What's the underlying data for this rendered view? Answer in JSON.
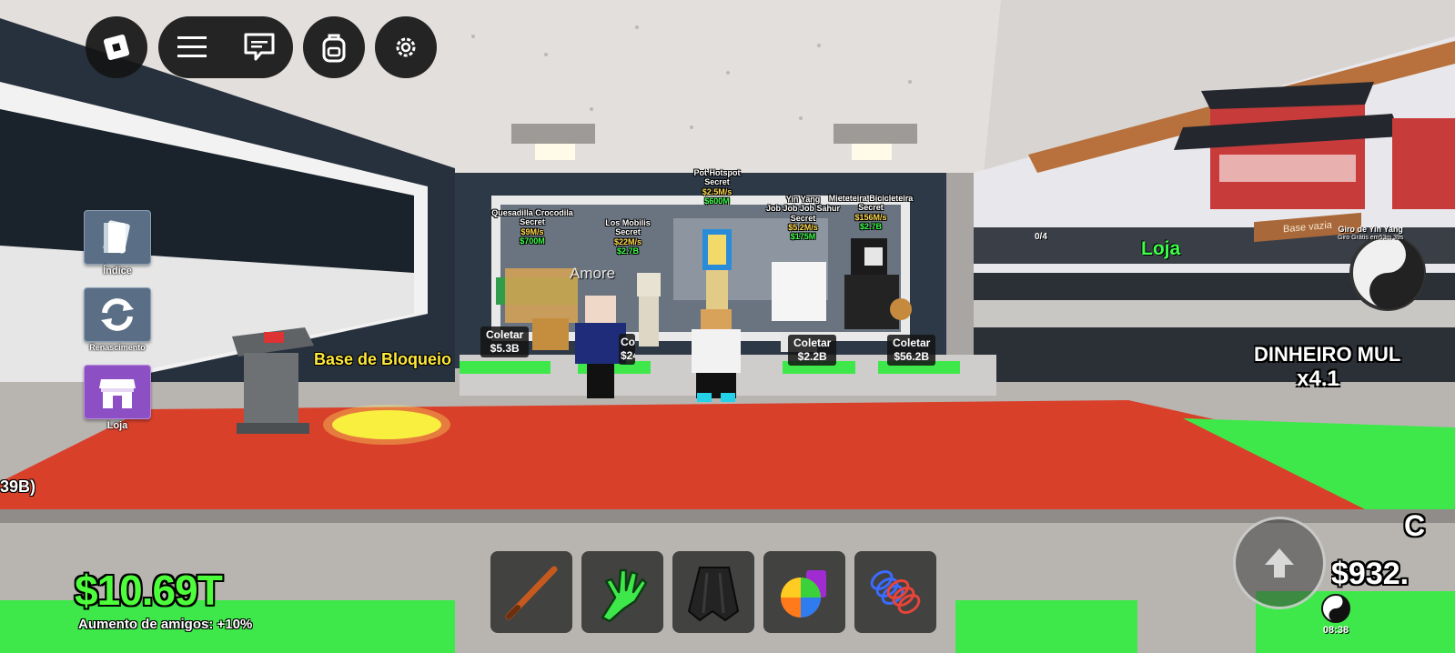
{
  "hud": {
    "icons": [
      "roblox-logo-icon",
      "menu-icon",
      "chat-icon",
      "backpack-icon",
      "settings-icon"
    ]
  },
  "side_menu": [
    {
      "label": "Índice",
      "icon": "book-icon",
      "color": "#5a6f86"
    },
    {
      "label": "Renascimento",
      "icon": "rebirth-icon",
      "color": "#5a6f86"
    },
    {
      "label": "Loja",
      "icon": "shop-icon",
      "color": "#8d4fc4"
    }
  ],
  "world": {
    "base_label": "Base de Bloqueio",
    "player_name": "Amore",
    "shop_sign": "Loja",
    "empty_base": "Base vazia",
    "counter": "0/4",
    "wheel_title": "Giro de Yin Yang",
    "wheel_sub": "Giro Grátis em53m 39s",
    "left_partial": "39B)"
  },
  "brainrots": [
    {
      "name": "Quesadilla Crocodila",
      "rarity": "Secret",
      "rate": "$9M/s",
      "price": "$700M",
      "collect": "Coletar",
      "amount": "$5.3B"
    },
    {
      "name": "Los Mobilis",
      "rarity": "Secret",
      "rate": "$22M/s",
      "price": "$2.7B",
      "collect": "Coletar",
      "amount": "$24B"
    },
    {
      "name": "Pot Hotspot",
      "rarity": "Secret",
      "rate": "$2.5M/s",
      "price": "$600M",
      "collect": "Coletar",
      "amount": ""
    },
    {
      "name": "Job Job Job Sahur",
      "rarity": "Secret",
      "rate": "$5.2M/s",
      "price": "$175M",
      "collect": "Coletar",
      "amount": "$2.2B"
    },
    {
      "name": "Mieteteira Bicicleteira",
      "rarity": "Secret",
      "rate": "$156M/s",
      "price": "$2.7B",
      "collect": "Coletar",
      "amount": "$56.2B"
    }
  ],
  "yin_yang_label": "Yin Yang",
  "money_multiplier": {
    "title": "DINHEIRO MUL",
    "value": "x4.1"
  },
  "currency": {
    "money": "$10.69T",
    "friends_boost": "Aumento de amigos: +10%",
    "right_money": "$932.",
    "right_letter": "C",
    "time": "08:38"
  },
  "hotbar": [
    {
      "icon": "bat-icon"
    },
    {
      "icon": "slap-glove-icon"
    },
    {
      "icon": "cape-icon"
    },
    {
      "icon": "rainbow-bag-icon"
    },
    {
      "icon": "spring-coil-icon"
    }
  ],
  "colors": {
    "money_green": "#4dff3a",
    "floor_red": "#d9402a",
    "base_green": "#3fe84a"
  }
}
